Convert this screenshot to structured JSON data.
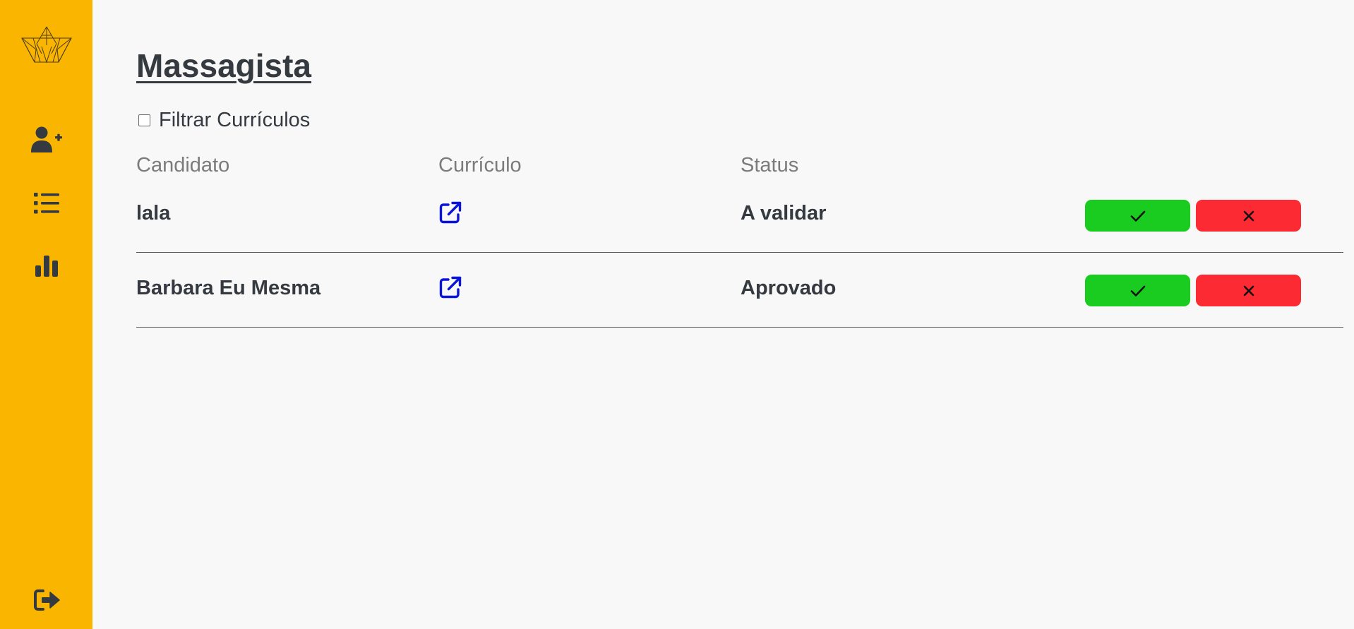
{
  "sidebar": {
    "logo_icon": "origami-logo",
    "items": [
      {
        "icon": "user-plus-icon"
      },
      {
        "icon": "list-icon"
      },
      {
        "icon": "bar-chart-icon"
      }
    ],
    "logout_icon": "sign-out-icon",
    "color": "#f9b500"
  },
  "page": {
    "title": "Massagista",
    "filter_label": "Filtrar Currículos",
    "filter_checked": false
  },
  "table": {
    "headers": {
      "candidate": "Candidato",
      "resume": "Currículo",
      "status": "Status"
    },
    "rows": [
      {
        "name": "lala",
        "status": "A validar",
        "resume_icon": "external-link-icon"
      },
      {
        "name": "Barbara Eu Mesma",
        "status": "Aprovado",
        "resume_icon": "external-link-icon"
      }
    ],
    "approve_color": "#19cc1f",
    "reject_color": "#fc2a32"
  }
}
